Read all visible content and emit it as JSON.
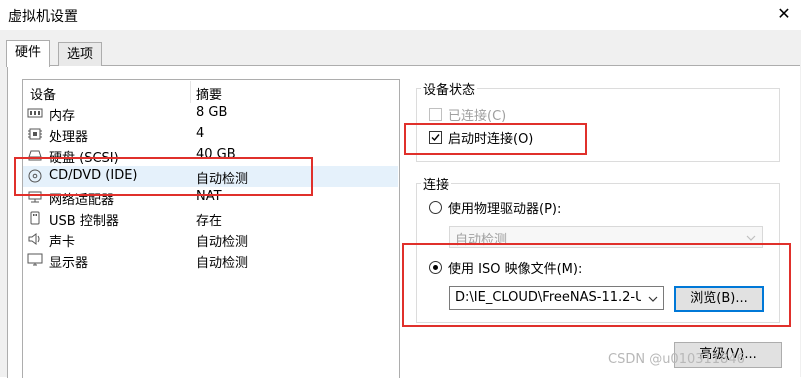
{
  "window": {
    "title": "虚拟机设置",
    "close_glyph": "✕"
  },
  "tabs": [
    {
      "label": "硬件"
    },
    {
      "label": "选项"
    }
  ],
  "device_list": {
    "columns": {
      "device": "设备",
      "summary": "摘要"
    },
    "rows": [
      {
        "icon": "memory-icon",
        "name": "内存",
        "summary": "8 GB"
      },
      {
        "icon": "cpu-icon",
        "name": "处理器",
        "summary": "4"
      },
      {
        "icon": "hard-disk-icon",
        "name": "硬盘 (SCSI)",
        "summary": "40 GB"
      },
      {
        "icon": "cd-dvd-icon",
        "name": "CD/DVD (IDE)",
        "summary": "自动检测"
      },
      {
        "icon": "network-adapter-icon",
        "name": "网络适配器",
        "summary": "NAT"
      },
      {
        "icon": "usb-icon",
        "name": "USB 控制器",
        "summary": "存在"
      },
      {
        "icon": "speaker-icon",
        "name": "声卡",
        "summary": "自动检测"
      },
      {
        "icon": "monitor-icon",
        "name": "显示器",
        "summary": "自动检测"
      }
    ],
    "selected_index": 3
  },
  "device_status": {
    "title": "设备状态",
    "connected": {
      "label": "已连接(C)",
      "checked": false,
      "enabled": false
    },
    "connect_at_power_on": {
      "label": "启动时连接(O)",
      "checked": true,
      "enabled": true
    }
  },
  "connection": {
    "title": "连接",
    "physical_drive": {
      "label": "使用物理驱动器(P):",
      "selected": false,
      "combo_value": "自动检测"
    },
    "iso_image": {
      "label": "使用 ISO 映像文件(M):",
      "selected": true,
      "path": "D:\\IE_CLOUD\\FreeNAS-11.2-U",
      "browse_label": "浏览(B)..."
    },
    "advanced_label": "高级(V)..."
  },
  "watermark": "CSDN @u010311846",
  "colors": {
    "highlight_red": "#e0302b",
    "selection_blue": "#e5f1fb",
    "focus_blue": "#0078d7"
  }
}
